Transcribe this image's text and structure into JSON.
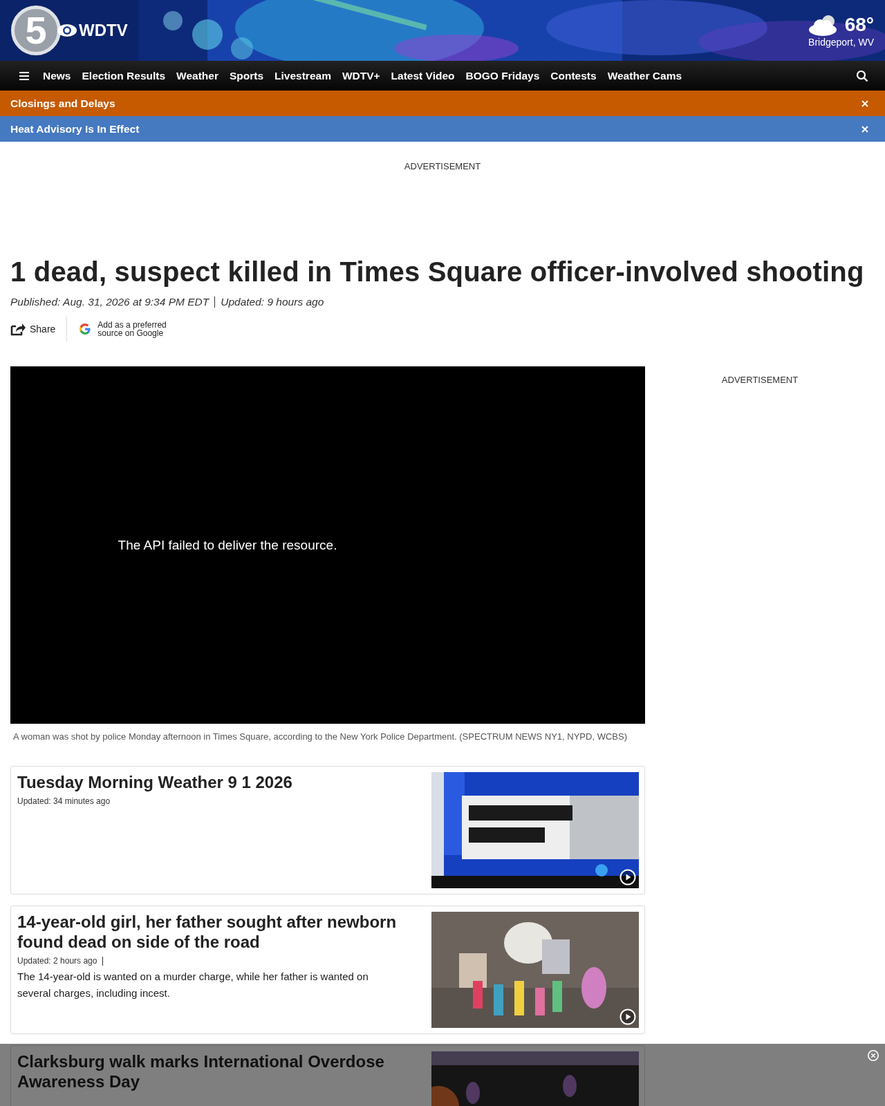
{
  "header": {
    "logo_number": "5",
    "logo_text": "WDTV",
    "temperature": "68°",
    "location": "Bridgeport, WV"
  },
  "nav": {
    "items": [
      "News",
      "Election Results",
      "Weather",
      "Sports",
      "Livestream",
      "WDTV+",
      "Latest Video",
      "BOGO Fridays",
      "Contests",
      "Weather Cams"
    ]
  },
  "alerts": [
    {
      "text": "Closings and Delays",
      "color": "#c55a00"
    },
    {
      "text": "Heat Advisory Is In Effect",
      "color": "#4579c0"
    }
  ],
  "top_ad": {
    "label": "ADVERTISEMENT"
  },
  "article": {
    "headline": "1 dead, suspect killed in Times Square officer-involved shooting",
    "published": "Published: Aug. 31, 2026 at 9:34 PM EDT",
    "updated": "Updated: 9 hours ago",
    "share": "Share",
    "google": "Add as a preferred source on Google"
  },
  "video": {
    "message": "The API failed to deliver the resource.",
    "caption": "A woman was shot by police Monday afternoon in Times Square, according to the New York Police Department. (SPECTRUM NEWS NY1, NYPD, WCBS)"
  },
  "side_ad": {
    "label": "ADVERTISEMENT"
  },
  "stories": [
    {
      "title": "Tuesday Morning Weather 9 1 2026",
      "updated": "Updated: 34 minutes ago",
      "video": true
    },
    {
      "title": "14-year-old girl, her father sought after newborn found dead on side of the road",
      "updated": "Updated: 2 hours ago",
      "summary": "The 14-year-old is wanted on a murder charge, while her father is wanted on several charges, including incest.",
      "video": true
    },
    {
      "title": "Clarksburg walk marks International Overdose Awareness Day"
    }
  ]
}
